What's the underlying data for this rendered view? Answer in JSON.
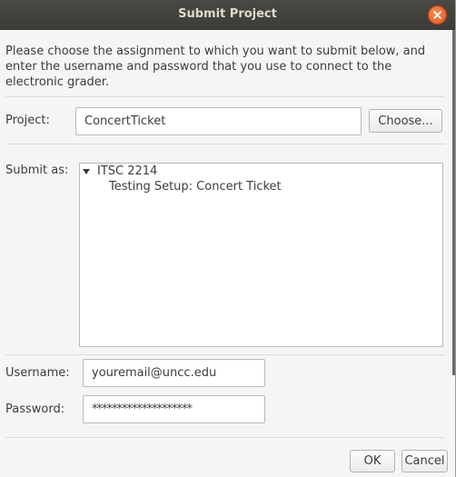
{
  "window": {
    "title": "Submit Project"
  },
  "intro_text": "Please choose the assignment to which you want to submit below, and enter the username and password that you use to connect to the electronic grader.",
  "project": {
    "label": "Project:",
    "value": "ConcertTicket",
    "choose_button": "Choose..."
  },
  "submit_as": {
    "label": "Submit as:",
    "tree": [
      {
        "label": "ITSC 2214",
        "expanded": true,
        "children": [
          {
            "label": "Testing Setup: Concert Ticket"
          }
        ]
      }
    ]
  },
  "username": {
    "label": "Username:",
    "value": "youremail@uncc.edu"
  },
  "password": {
    "label": "Password:",
    "value": "********************"
  },
  "buttons": {
    "ok": "OK",
    "cancel": "Cancel"
  },
  "icons": {
    "close": "close-icon",
    "expander": "triangle-down-icon"
  },
  "colors": {
    "titlebar": "#3c3b37",
    "close_button": "#e9541e"
  }
}
